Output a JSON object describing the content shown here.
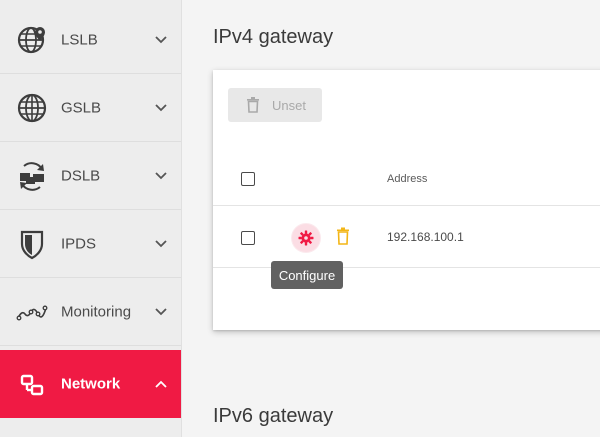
{
  "sidebar": {
    "items": [
      {
        "label": "LSLB",
        "icon": "globe-pin-icon",
        "active": false
      },
      {
        "label": "GSLB",
        "icon": "globe-icon",
        "active": false
      },
      {
        "label": "DSLB",
        "icon": "datacenter-sync-icon",
        "active": false
      },
      {
        "label": "IPDS",
        "icon": "shield-icon",
        "active": false
      },
      {
        "label": "Monitoring",
        "icon": "line-graph-icon",
        "active": false
      },
      {
        "label": "Network",
        "icon": "network-icon",
        "active": true
      }
    ],
    "active_color": "#f01a44"
  },
  "ipv4": {
    "title": "IPv4 gateway",
    "unset_label": "Unset",
    "columns": {
      "address": "Address"
    },
    "rows": [
      {
        "address": "192.168.100.1"
      }
    ],
    "tooltip": "Configure"
  },
  "ipv6": {
    "title": "IPv6 gateway"
  },
  "colors": {
    "accent": "#f01a44",
    "delete_icon": "#f3b617",
    "tooltip_bg": "#616161"
  }
}
